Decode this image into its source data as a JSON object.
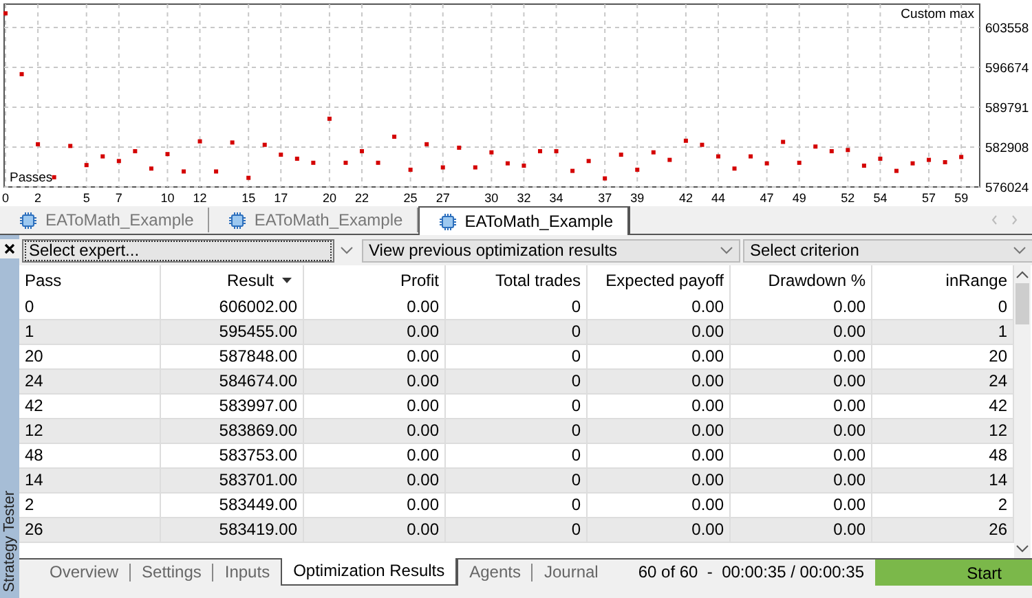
{
  "chart": {
    "chart_data": {
      "type": "scatter",
      "xlabel": "Passes",
      "grid": true,
      "x": [
        0,
        1,
        2,
        3,
        4,
        5,
        6,
        7,
        8,
        9,
        10,
        11,
        12,
        13,
        14,
        15,
        16,
        17,
        18,
        19,
        20,
        21,
        22,
        23,
        24,
        25,
        26,
        27,
        28,
        29,
        30,
        31,
        32,
        33,
        34,
        35,
        36,
        37,
        38,
        39,
        40,
        41,
        42,
        43,
        44,
        45,
        46,
        47,
        48,
        49,
        50,
        51,
        52,
        53,
        54,
        55,
        56,
        57,
        58,
        59
      ],
      "series": [
        {
          "name": "Custom max",
          "color": "#d40000",
          "values": [
            606000,
            595500,
            583400,
            577700,
            583100,
            579800,
            581300,
            580500,
            582200,
            579200,
            581700,
            578700,
            583900,
            578700,
            583700,
            577600,
            583300,
            581600,
            580900,
            580200,
            587800,
            580200,
            582200,
            580200,
            584700,
            579000,
            583400,
            579400,
            582800,
            579400,
            582000,
            580100,
            579700,
            582200,
            582200,
            578800,
            580500,
            577500,
            581600,
            579000,
            582000,
            580700,
            584000,
            583300,
            581300,
            579200,
            581300,
            580100,
            583800,
            580200,
            583000,
            582200,
            582400,
            579700,
            580900,
            578800,
            580100,
            580700,
            580300,
            581200
          ]
        }
      ],
      "xlim": [
        0,
        59.8
      ],
      "ylim": [
        576024,
        607590
      ],
      "xticks": [
        0,
        2,
        5,
        7,
        10,
        12,
        15,
        17,
        20,
        22,
        25,
        27,
        30,
        32,
        34,
        37,
        39,
        42,
        44,
        47,
        49,
        52,
        54,
        57,
        59
      ],
      "yticks": [
        576024,
        582908,
        589791,
        596674,
        603558
      ]
    }
  },
  "tabs": [
    {
      "label": "EAToMath_Example",
      "selected": false
    },
    {
      "label": "EAToMath_Example",
      "selected": false
    },
    {
      "label": "EAToMath_Example",
      "selected": true
    }
  ],
  "side_panel": {
    "title": "Strategy Tester"
  },
  "toolbar": {
    "expert": {
      "value": "Select expert..."
    },
    "history": {
      "value": "View previous optimization results"
    },
    "criterion": {
      "value": "Select criterion"
    }
  },
  "table": {
    "columns": [
      {
        "label": "Pass",
        "sorted": false
      },
      {
        "label": "Result",
        "sorted": true
      },
      {
        "label": "Profit",
        "sorted": false
      },
      {
        "label": "Total trades",
        "sorted": false
      },
      {
        "label": "Expected payoff",
        "sorted": false
      },
      {
        "label": "Drawdown %",
        "sorted": false
      },
      {
        "label": "inRange",
        "sorted": false
      }
    ],
    "rows": [
      [
        "0",
        "606002.00",
        "0.00",
        "0",
        "0.00",
        "0.00",
        "0"
      ],
      [
        "1",
        "595455.00",
        "0.00",
        "0",
        "0.00",
        "0.00",
        "1"
      ],
      [
        "20",
        "587848.00",
        "0.00",
        "0",
        "0.00",
        "0.00",
        "20"
      ],
      [
        "24",
        "584674.00",
        "0.00",
        "0",
        "0.00",
        "0.00",
        "24"
      ],
      [
        "42",
        "583997.00",
        "0.00",
        "0",
        "0.00",
        "0.00",
        "42"
      ],
      [
        "12",
        "583869.00",
        "0.00",
        "0",
        "0.00",
        "0.00",
        "12"
      ],
      [
        "48",
        "583753.00",
        "0.00",
        "0",
        "0.00",
        "0.00",
        "48"
      ],
      [
        "14",
        "583701.00",
        "0.00",
        "0",
        "0.00",
        "0.00",
        "14"
      ],
      [
        "2",
        "583449.00",
        "0.00",
        "0",
        "0.00",
        "0.00",
        "2"
      ],
      [
        "26",
        "583419.00",
        "0.00",
        "0",
        "0.00",
        "0.00",
        "26"
      ]
    ]
  },
  "bottom_tabs": [
    {
      "label": "Overview",
      "selected": false
    },
    {
      "label": "Settings",
      "selected": false
    },
    {
      "label": "Inputs",
      "selected": false
    },
    {
      "label": "Optimization Results",
      "selected": true
    },
    {
      "label": "Agents",
      "selected": false
    },
    {
      "label": "Journal",
      "selected": false
    }
  ],
  "status": {
    "progress": "60 of 60  -  00:00:35 / 00:00:35",
    "start_button": "Start"
  }
}
